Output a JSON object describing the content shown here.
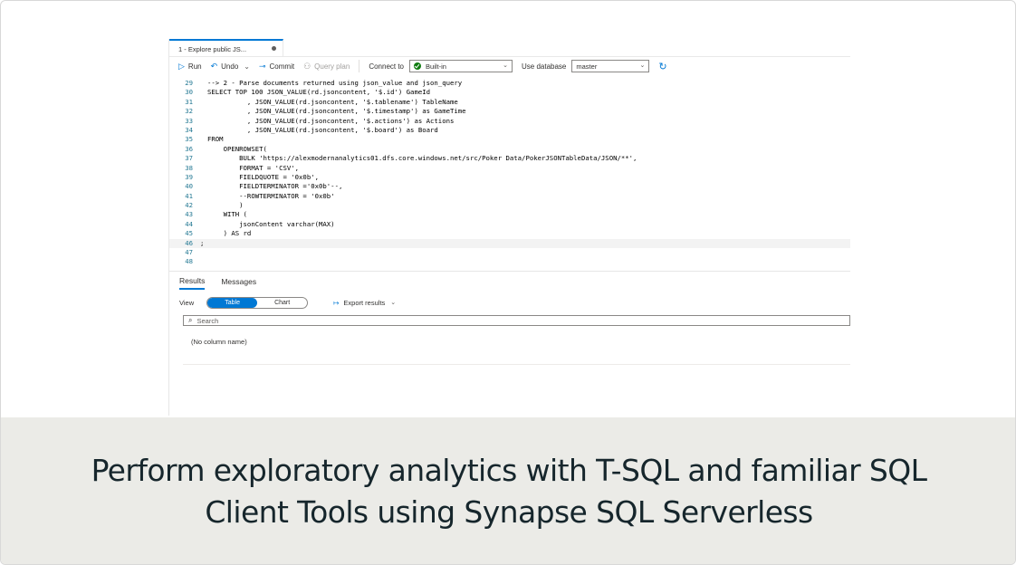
{
  "tab": {
    "title": "1 - Explore public JS..."
  },
  "toolbar": {
    "run_label": "Run",
    "undo_label": "Undo",
    "commit_label": "Commit",
    "query_plan_label": "Query plan",
    "connect_to_label": "Connect to",
    "connection_value": "Built-in",
    "use_database_label": "Use database",
    "database_value": "master"
  },
  "code_lines": [
    {
      "num": "29",
      "text": "--> 2 - Parse documents returned using json_value and json_query"
    },
    {
      "num": "30",
      "text": "SELECT TOP 100 JSON_VALUE(rd.jsoncontent, '$.id') GameId"
    },
    {
      "num": "31",
      "text": "          , JSON_VALUE(rd.jsoncontent, '$.tablename') TableName"
    },
    {
      "num": "32",
      "text": "          , JSON_VALUE(rd.jsoncontent, '$.timestamp') as GameTime"
    },
    {
      "num": "33",
      "text": "          , JSON_VALUE(rd.jsoncontent, '$.actions') as Actions"
    },
    {
      "num": "34",
      "text": "          , JSON_VALUE(rd.jsoncontent, '$.board') as Board"
    },
    {
      "num": "35",
      "text": "FROM"
    },
    {
      "num": "36",
      "text": "    OPENROWSET("
    },
    {
      "num": "37",
      "text": "        BULK 'https://alexmodernanalytics01.dfs.core.windows.net/src/Poker Data/PokerJSONTableData/JSON/**',"
    },
    {
      "num": "38",
      "text": "        FORMAT = 'CSV',"
    },
    {
      "num": "39",
      "text": "        FIELDQUOTE = '0x0b',"
    },
    {
      "num": "40",
      "text": "        FIELDTERMINATOR ='0x0b'--,"
    },
    {
      "num": "41",
      "text": "        --ROWTERMINATOR = '0x0b'"
    },
    {
      "num": "42",
      "text": "        )"
    },
    {
      "num": "43",
      "text": "    WITH ("
    },
    {
      "num": "44",
      "text": "        jsonContent varchar(MAX)"
    },
    {
      "num": "45",
      "text": "    ) AS rd"
    },
    {
      "num": "46",
      "text": ";"
    },
    {
      "num": "47",
      "text": ""
    },
    {
      "num": "48",
      "text": ""
    }
  ],
  "results": {
    "tab_results": "Results",
    "tab_messages": "Messages",
    "view_label": "View",
    "view_table": "Table",
    "view_chart": "Chart",
    "export_label": "Export results",
    "search_placeholder": "Search",
    "column_header": "(No column name)"
  },
  "banner": {
    "line1": "Perform exploratory analytics with T-SQL and familiar SQL",
    "line2": "Client Tools using Synapse SQL Serverless"
  },
  "colors": {
    "accent": "#0078d4",
    "connected": "#107c10",
    "banner_bg": "#ebebe7",
    "banner_text": "#16262c"
  }
}
